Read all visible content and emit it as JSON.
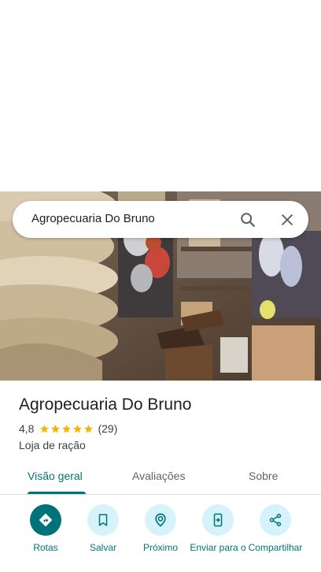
{
  "search": {
    "query": "Agropecuaria Do Bruno"
  },
  "place": {
    "name": "Agropecuaria Do Bruno",
    "rating": "4,8",
    "stars": 5,
    "review_count": "(29)",
    "category": "Loja de ração"
  },
  "tabs": [
    {
      "label": "Visão geral",
      "active": true
    },
    {
      "label": "Avaliações",
      "active": false
    },
    {
      "label": "Sobre",
      "active": false
    }
  ],
  "actions": [
    {
      "label": "Rotas",
      "icon": "directions-icon"
    },
    {
      "label": "Salvar",
      "icon": "bookmark-icon"
    },
    {
      "label": "Próximo",
      "icon": "nearby-icon"
    },
    {
      "label": "Enviar para o",
      "icon": "send-to-phone-icon"
    },
    {
      "label": "Compartilhar",
      "icon": "share-icon"
    }
  ],
  "colors": {
    "accent": "#00727a",
    "action_bg": "#d6f3fb",
    "star": "#f5b400"
  }
}
